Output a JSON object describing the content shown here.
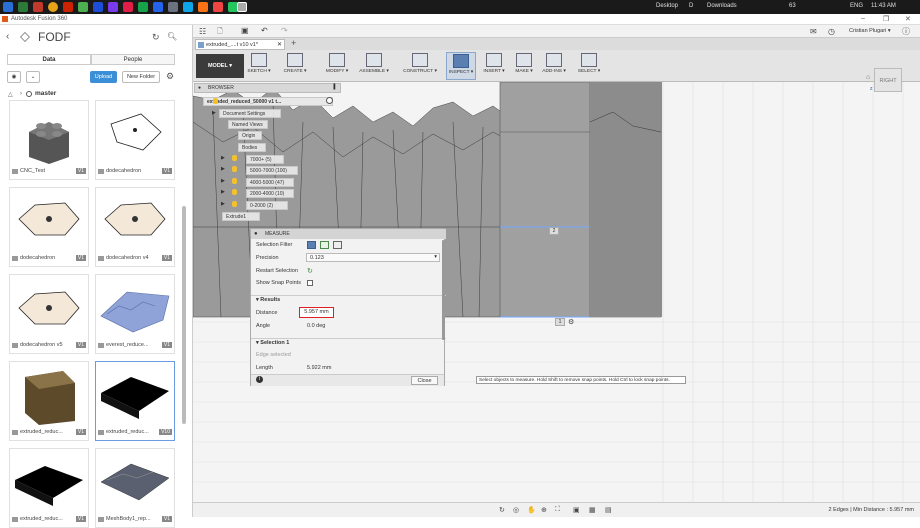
{
  "taskbar": {
    "desktop_label": "Desktop",
    "d_label": "D",
    "downloads_label": "Downloads",
    "lang": "ENG",
    "time": "11:43 AM",
    "battery": "63"
  },
  "window": {
    "title": "Autodesk Fusion 360",
    "minimize": "–",
    "restore": "❐",
    "close": "✕"
  },
  "data_panel": {
    "project_name": "FODF",
    "tab_data": "Data",
    "tab_people": "People",
    "upload_label": "Upload",
    "new_folder_label": "New Folder",
    "breadcrumb": "master",
    "items": [
      {
        "name": "CNC_Test",
        "version": "V1"
      },
      {
        "name": "dodecahedron",
        "version": "V1"
      },
      {
        "name": "dodecahedron",
        "version": "V1"
      },
      {
        "name": "dodecahedron v4",
        "version": "V1"
      },
      {
        "name": "dodecahedron v5",
        "version": "V1"
      },
      {
        "name": "everest_reduce...",
        "version": "V1"
      },
      {
        "name": "extruded_reduc...",
        "version": "V1"
      },
      {
        "name": "extruded_reduc...",
        "version": "V10"
      },
      {
        "name": "extruded_reduc...",
        "version": "V1"
      },
      {
        "name": "MeshBody1_rep...",
        "version": "V1"
      }
    ]
  },
  "header": {
    "user_name": "Cristian Plugari ▾",
    "doc_tab_title": "extruded_....t v10 v1*",
    "add_tab": "+"
  },
  "toolbar": {
    "model_label": "MODEL ▾",
    "tools": [
      {
        "label": "SKETCH ▾"
      },
      {
        "label": "CREATE ▾"
      },
      {
        "label": "MODIFY ▾"
      },
      {
        "label": "ASSEMBLE ▾"
      },
      {
        "label": "CONSTRUCT ▾"
      },
      {
        "label": "INSPECT ▾"
      },
      {
        "label": "INSERT ▾"
      },
      {
        "label": "MAKE ▾"
      },
      {
        "label": "ADD-INS ▾"
      },
      {
        "label": "SELECT ▾"
      }
    ]
  },
  "browser": {
    "header": "BROWSER",
    "root": "extruded_reduced_50000 v1 t...",
    "items": [
      "Document Settings",
      "Named Views",
      "Origin",
      "Bodies",
      "7000+ (5)",
      "5000-7000 (100)",
      "4000-5000 (47)",
      "2000-4000 (10)",
      "0-2000 (2)",
      "Extrude1"
    ]
  },
  "measure": {
    "title": "MEASURE",
    "selection_filter_label": "Selection Filter",
    "precision_label": "Precision",
    "precision_value": "0.123",
    "restart_label": "Restart Selection",
    "snap_label": "Show Snap Points",
    "results_label": "Results",
    "distance_label": "Distance",
    "distance_value": "5.957 mm",
    "angle_label": "Angle",
    "angle_value": "0.0 deg",
    "selection1_label": "Selection 1",
    "edge_selected": "Edge selected",
    "length_label": "Length",
    "length_value": "5.922 mm",
    "close_label": "Close"
  },
  "viewport": {
    "label_2": "2",
    "label_1": "1",
    "viewcube": "RIGHT",
    "hint": "Select objects to measure. Hold Shift to remove snap points. Hold Ctrl to lock snap points."
  },
  "status": {
    "text": "2 Edges | Min Distance : 5.957 mm"
  }
}
